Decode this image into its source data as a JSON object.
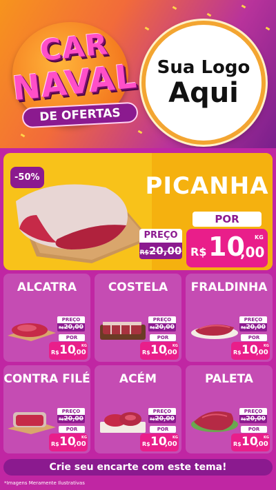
{
  "colors": {
    "header_orange": "#f7941d",
    "header_purple": "#7a1f8c",
    "page_magenta": "#c026a3",
    "card_bg": "#c54cb3",
    "featured_yellow": "#f8c21a",
    "price_pink": "#e91e8a",
    "label_purple": "#8b1a8f"
  },
  "header": {
    "title_line1": "CAR",
    "title_line2": "NAVAL",
    "title_line3": "DE OFERTAS",
    "logo_line1": "Sua Logo",
    "logo_line2": "Aqui"
  },
  "featured": {
    "discount": "-50%",
    "name": "PICANHA",
    "preco_label": "PREÇO",
    "old_currency": "R$",
    "old_price": "20,00",
    "por_label": "POR",
    "currency": "R$",
    "price_int": "10",
    "price_cents": ",00",
    "unit": "KG"
  },
  "products": [
    {
      "name": "ALCATRA",
      "preco_label": "PREÇO",
      "old_currency": "R$",
      "old_price": "20,00",
      "por_label": "POR",
      "currency": "R$",
      "price_int": "10",
      "price_cents": ",00",
      "unit": "KG"
    },
    {
      "name": "COSTELA",
      "preco_label": "PREÇO",
      "old_currency": "R$",
      "old_price": "20,00",
      "por_label": "POR",
      "currency": "R$",
      "price_int": "10",
      "price_cents": ",00",
      "unit": "KG"
    },
    {
      "name": "FRALDINHA",
      "preco_label": "PREÇO",
      "old_currency": "R$",
      "old_price": "20,00",
      "por_label": "POR",
      "currency": "R$",
      "price_int": "10",
      "price_cents": ",00",
      "unit": "KG"
    },
    {
      "name": "CONTRA FILÉ",
      "preco_label": "PREÇO",
      "old_currency": "R$",
      "old_price": "20,00",
      "por_label": "POR",
      "currency": "R$",
      "price_int": "10",
      "price_cents": ",00",
      "unit": "KG"
    },
    {
      "name": "ACÉM",
      "preco_label": "PREÇO",
      "old_currency": "R$",
      "old_price": "20,00",
      "por_label": "POR",
      "currency": "R$",
      "price_int": "10",
      "price_cents": ",00",
      "unit": "KG"
    },
    {
      "name": "PALETA",
      "preco_label": "PREÇO",
      "old_currency": "R$",
      "old_price": "20,00",
      "por_label": "POR",
      "currency": "R$",
      "price_int": "10",
      "price_cents": ",00",
      "unit": "KG"
    }
  ],
  "cta": "Crie seu encarte com este tema!",
  "disclaimer": "*Imagens Meramente Ilustrativas"
}
